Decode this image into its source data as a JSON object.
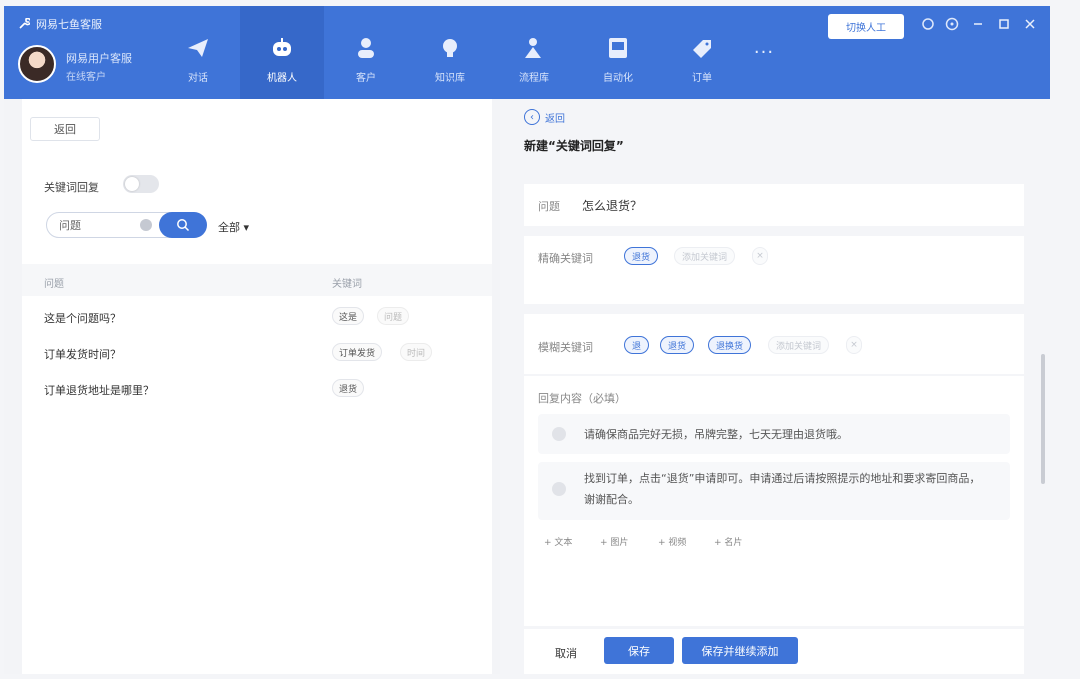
{
  "app": {
    "title": "网易七鱼客服"
  },
  "user": {
    "name": "网易用户客服",
    "status": "在线客户"
  },
  "nav": {
    "items": [
      {
        "label": "对话",
        "icon": "paper-plane-icon"
      },
      {
        "label": "机器人",
        "icon": "robot-icon"
      },
      {
        "label": "客户",
        "icon": "person-icon"
      },
      {
        "label": "知识库",
        "icon": "lightbulb-icon"
      },
      {
        "label": "流程库",
        "icon": "user-flow-icon"
      },
      {
        "label": "自动化",
        "icon": "picture-icon"
      },
      {
        "label": "订单",
        "icon": "tag-icon"
      }
    ],
    "active_index": 1,
    "more": "···"
  },
  "header": {
    "action_button": "切换人工"
  },
  "left": {
    "back": "返回",
    "keyword_reply_label": "关键词回复",
    "search": {
      "value": "问题"
    },
    "filter": "全部 ▾",
    "columns": [
      "问题",
      "关键词"
    ],
    "rows": [
      {
        "question": "这是个问题吗？",
        "tags": [
          "这是",
          "问题"
        ]
      },
      {
        "question": "订单发货时间？",
        "tags": [
          "订单发货",
          "时间"
        ]
      },
      {
        "question": "订单退货地址是哪里？",
        "tags": [
          "退货"
        ]
      }
    ]
  },
  "right": {
    "back": "返回",
    "title": "新建“关键词回复”",
    "question_label": "问题",
    "question_value": "怎么退货？",
    "exact_label": "精确关键词",
    "exact_chips": [
      "退货",
      "添加关键词"
    ],
    "fuzzy_label": "模糊关键词",
    "fuzzy_chips": [
      "退",
      "退货",
      "退换货",
      "添加关键词"
    ],
    "reply_label": "回复内容（必填）",
    "replies": [
      "请确保商品完好无损，吊牌完整，七天无理由退货哦。",
      "找到订单，点击“退货”申请即可。申请通过后请按照提示的地址和要求寄回商品，谢谢配合。"
    ],
    "add_options": [
      "+ 文本",
      "+ 图片",
      "+ 视频",
      "+ 名片"
    ],
    "cancel": "取消",
    "save": "保存",
    "save_continue": "保存并继续添加"
  },
  "colors": {
    "primary": "#3f74d8",
    "header": "#3f74d8",
    "active_nav": "#3668c9"
  }
}
